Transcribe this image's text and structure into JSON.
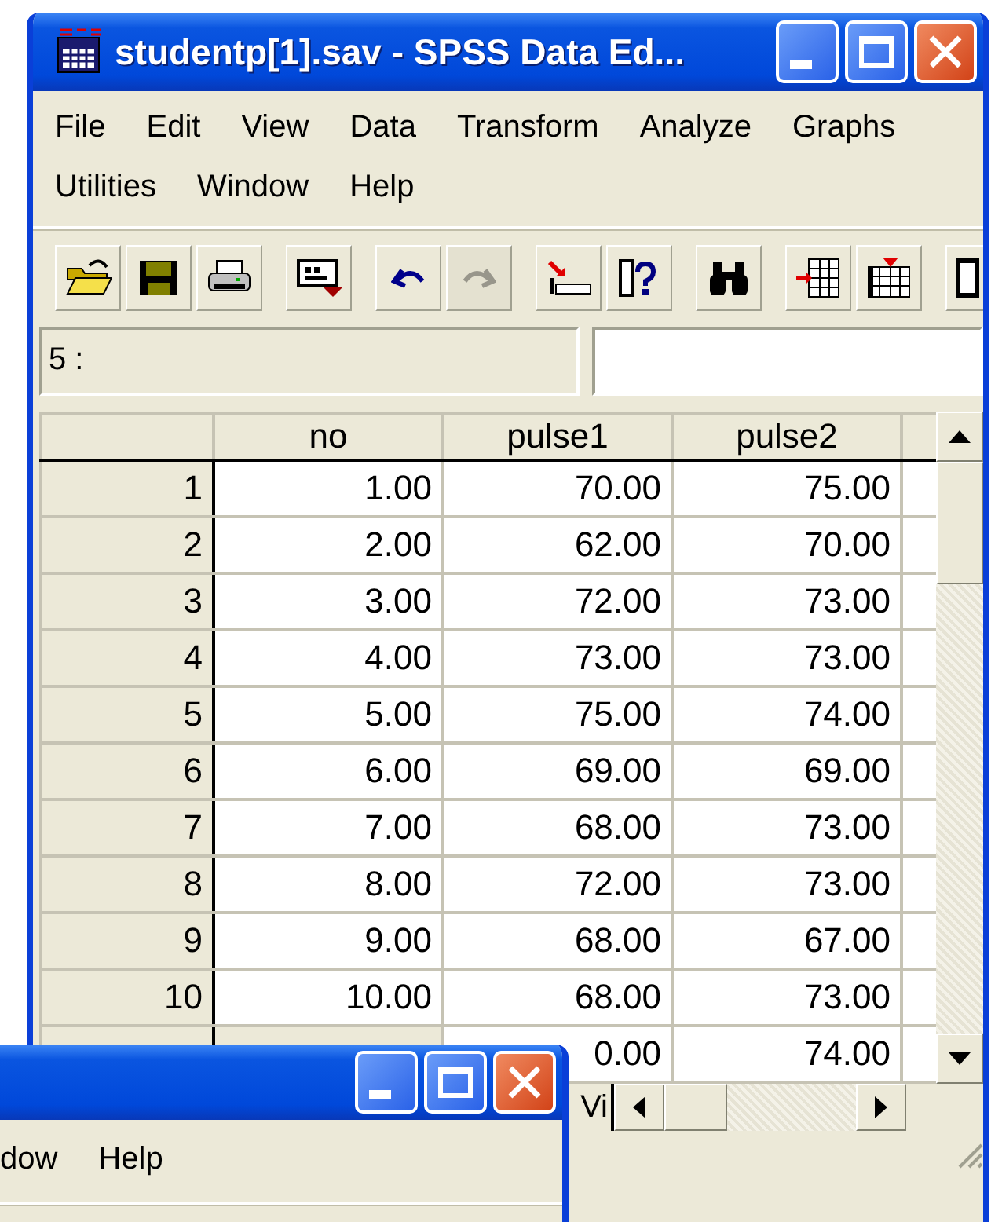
{
  "main_window": {
    "title": "studentp[1].sav - SPSS Data Ed...",
    "menu_rows": [
      [
        "File",
        "Edit",
        "View",
        "Data",
        "Transform",
        "Analyze",
        "Graphs"
      ],
      [
        "Utilities",
        "Window",
        "Help"
      ]
    ],
    "toolbar_groups": [
      [
        {
          "kind": "open",
          "disabled": false
        },
        {
          "kind": "save",
          "disabled": false
        },
        {
          "kind": "print",
          "disabled": false
        }
      ],
      [
        {
          "kind": "dialog",
          "disabled": false
        }
      ],
      [
        {
          "kind": "undo",
          "disabled": false
        },
        {
          "kind": "redo",
          "disabled": true
        }
      ],
      [
        {
          "kind": "goto",
          "disabled": false
        },
        {
          "kind": "variables",
          "disabled": false
        }
      ],
      [
        {
          "kind": "find",
          "disabled": false
        }
      ],
      [
        {
          "kind": "insert-cases",
          "disabled": false
        },
        {
          "kind": "insert-variable",
          "disabled": false
        }
      ],
      [
        {
          "kind": "split",
          "disabled": false
        }
      ]
    ],
    "cell_editor": {
      "cell": "5 :"
    },
    "grid": {
      "columns": [
        "no",
        "pulse1",
        "pulse2"
      ],
      "rows": [
        {
          "label": "1",
          "cells": [
            "1.00",
            "70.00",
            "75.00"
          ]
        },
        {
          "label": "2",
          "cells": [
            "2.00",
            "62.00",
            "70.00"
          ]
        },
        {
          "label": "3",
          "cells": [
            "3.00",
            "72.00",
            "73.00"
          ]
        },
        {
          "label": "4",
          "cells": [
            "4.00",
            "73.00",
            "73.00"
          ]
        },
        {
          "label": "5",
          "cells": [
            "5.00",
            "75.00",
            "74.00"
          ]
        },
        {
          "label": "6",
          "cells": [
            "6.00",
            "69.00",
            "69.00"
          ]
        },
        {
          "label": "7",
          "cells": [
            "7.00",
            "68.00",
            "73.00"
          ]
        },
        {
          "label": "8",
          "cells": [
            "8.00",
            "72.00",
            "73.00"
          ]
        },
        {
          "label": "9",
          "cells": [
            "9.00",
            "68.00",
            "67.00"
          ]
        },
        {
          "label": "10",
          "cells": [
            "10.00",
            "68.00",
            "73.00"
          ]
        }
      ],
      "partial_row_cells": [
        "0.00",
        "74.00"
      ]
    },
    "sheet_tabs": [
      "Vi"
    ]
  },
  "second_window": {
    "menu": [
      "dow",
      "Help"
    ]
  }
}
